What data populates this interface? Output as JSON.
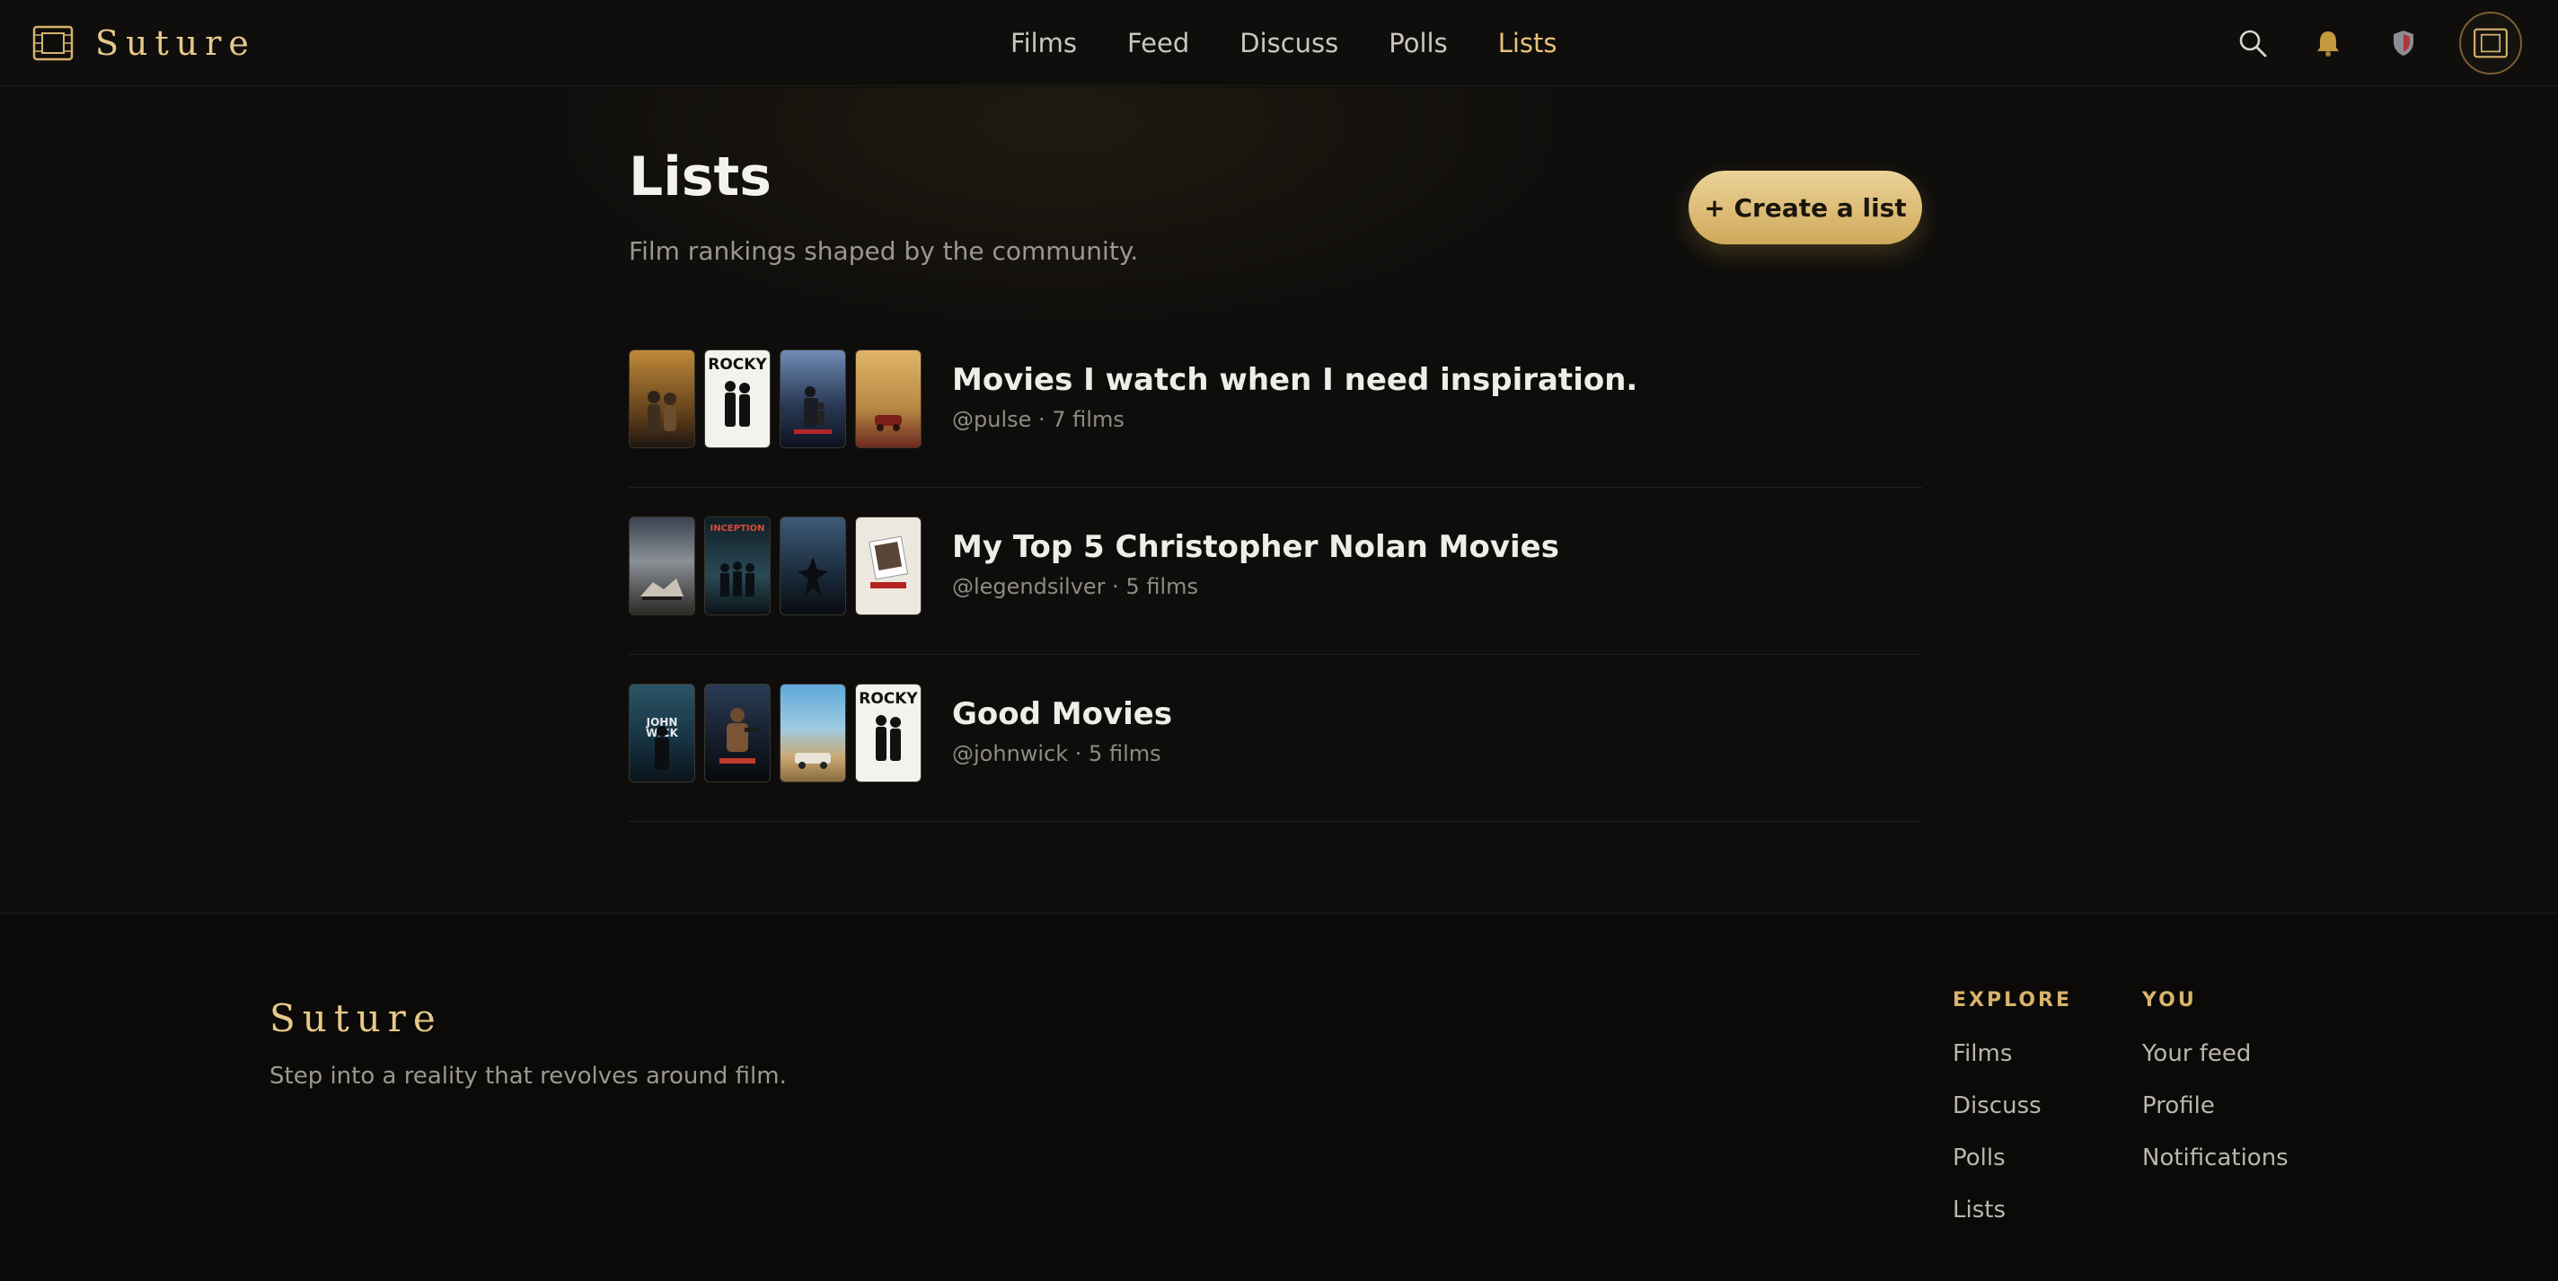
{
  "brand": {
    "name": "Suture"
  },
  "nav": {
    "items": [
      "Films",
      "Feed",
      "Discuss",
      "Polls",
      "Lists"
    ],
    "active": "Lists"
  },
  "header_icons": [
    "search-icon",
    "bell-icon",
    "shield-icon",
    "film-avatar-icon"
  ],
  "page": {
    "title": "Lists",
    "subtitle": "Film rankings shaped by the community.",
    "create_button": "+ Create a list"
  },
  "lists": [
    {
      "title": "Movies I watch when I need inspiration.",
      "meta": "@pulse · 7 films",
      "posters": [
        {
          "label": "",
          "bg": "#8a5a22"
        },
        {
          "label": "ROCKY",
          "bg": "#f2f0ea"
        },
        {
          "label": "",
          "bg": "#3a4a66"
        },
        {
          "label": "",
          "bg": "#b78843"
        }
      ]
    },
    {
      "title": "My Top 5 Christopher Nolan Movies",
      "meta": "@legendsilver · 5 films",
      "posters": [
        {
          "label": "",
          "bg": "#5a6470"
        },
        {
          "label": "INCEPTION",
          "bg": "#1b2a33"
        },
        {
          "label": "",
          "bg": "#22303e"
        },
        {
          "label": "",
          "bg": "#e8e4dc"
        }
      ]
    },
    {
      "title": "Good Movies",
      "meta": "@johnwick · 5 films",
      "posters": [
        {
          "label": "JOHN WICK",
          "bg": "#1f3c4a"
        },
        {
          "label": "",
          "bg": "#1a2430"
        },
        {
          "label": "",
          "bg": "#5d9ec8"
        },
        {
          "label": "ROCKY",
          "bg": "#f2f0ea"
        }
      ]
    }
  ],
  "footer": {
    "brand": "Suture",
    "tagline": "Step into a reality that revolves around film.",
    "explore": {
      "heading": "EXPLORE",
      "links": [
        "Films",
        "Discuss",
        "Polls",
        "Lists"
      ]
    },
    "you": {
      "heading": "YOU",
      "links": [
        "Your feed",
        "Profile",
        "Notifications"
      ]
    }
  },
  "colors": {
    "accent": "#e6c27a",
    "background": "#0e0d0c",
    "button": "#ddbd77"
  }
}
